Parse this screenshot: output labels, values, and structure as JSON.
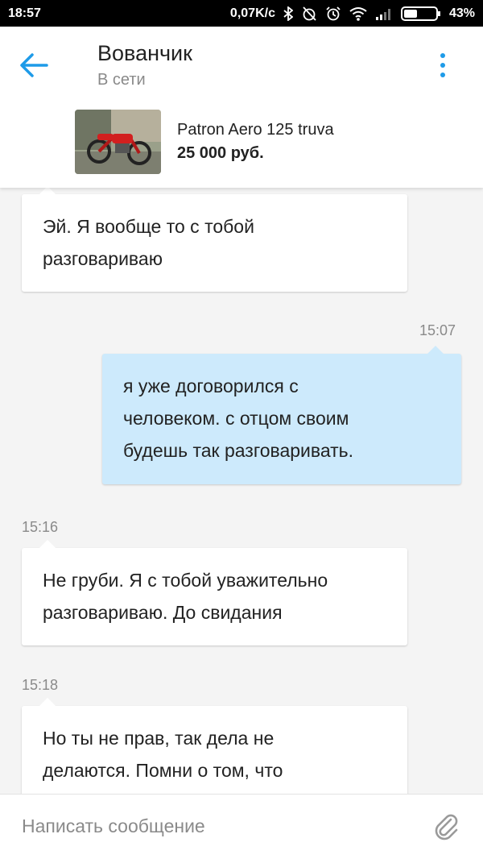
{
  "status_bar": {
    "time": "18:57",
    "network_speed": "0,07K/c",
    "battery": "43%"
  },
  "header": {
    "contact_name": "Вованчик",
    "contact_status": "В сети",
    "ad_title": "Patron Aero 125 truva",
    "ad_price": "25 000 руб."
  },
  "messages": [
    {
      "direction": "in",
      "time": "",
      "text_lines": [
        "Эй. Я вообще то с тобой",
        "разговариваю"
      ]
    },
    {
      "direction": "out",
      "time": "15:07",
      "text_lines": [
        "я уже договорился с",
        "человеком. с отцом своим",
        "будешь так разговаривать."
      ]
    },
    {
      "direction": "in",
      "time": "15:16",
      "text_lines": [
        "Не груби. Я с тобой уважительно",
        "разговариваю. До свидания"
      ]
    },
    {
      "direction": "in",
      "time": "15:18",
      "text_lines": [
        "Но ты не прав, так дела не",
        "делаются. Помни о том, что"
      ]
    }
  ],
  "composer": {
    "placeholder": "Написать сообщение"
  },
  "icons": {
    "back": "arrow-left-icon",
    "menu": "more-vert-icon",
    "attach": "paperclip-icon"
  },
  "colors": {
    "accent": "#1e9be8",
    "outgoing_bubble": "#cdeafc",
    "incoming_bubble": "#ffffff",
    "background": "#f4f4f4"
  }
}
